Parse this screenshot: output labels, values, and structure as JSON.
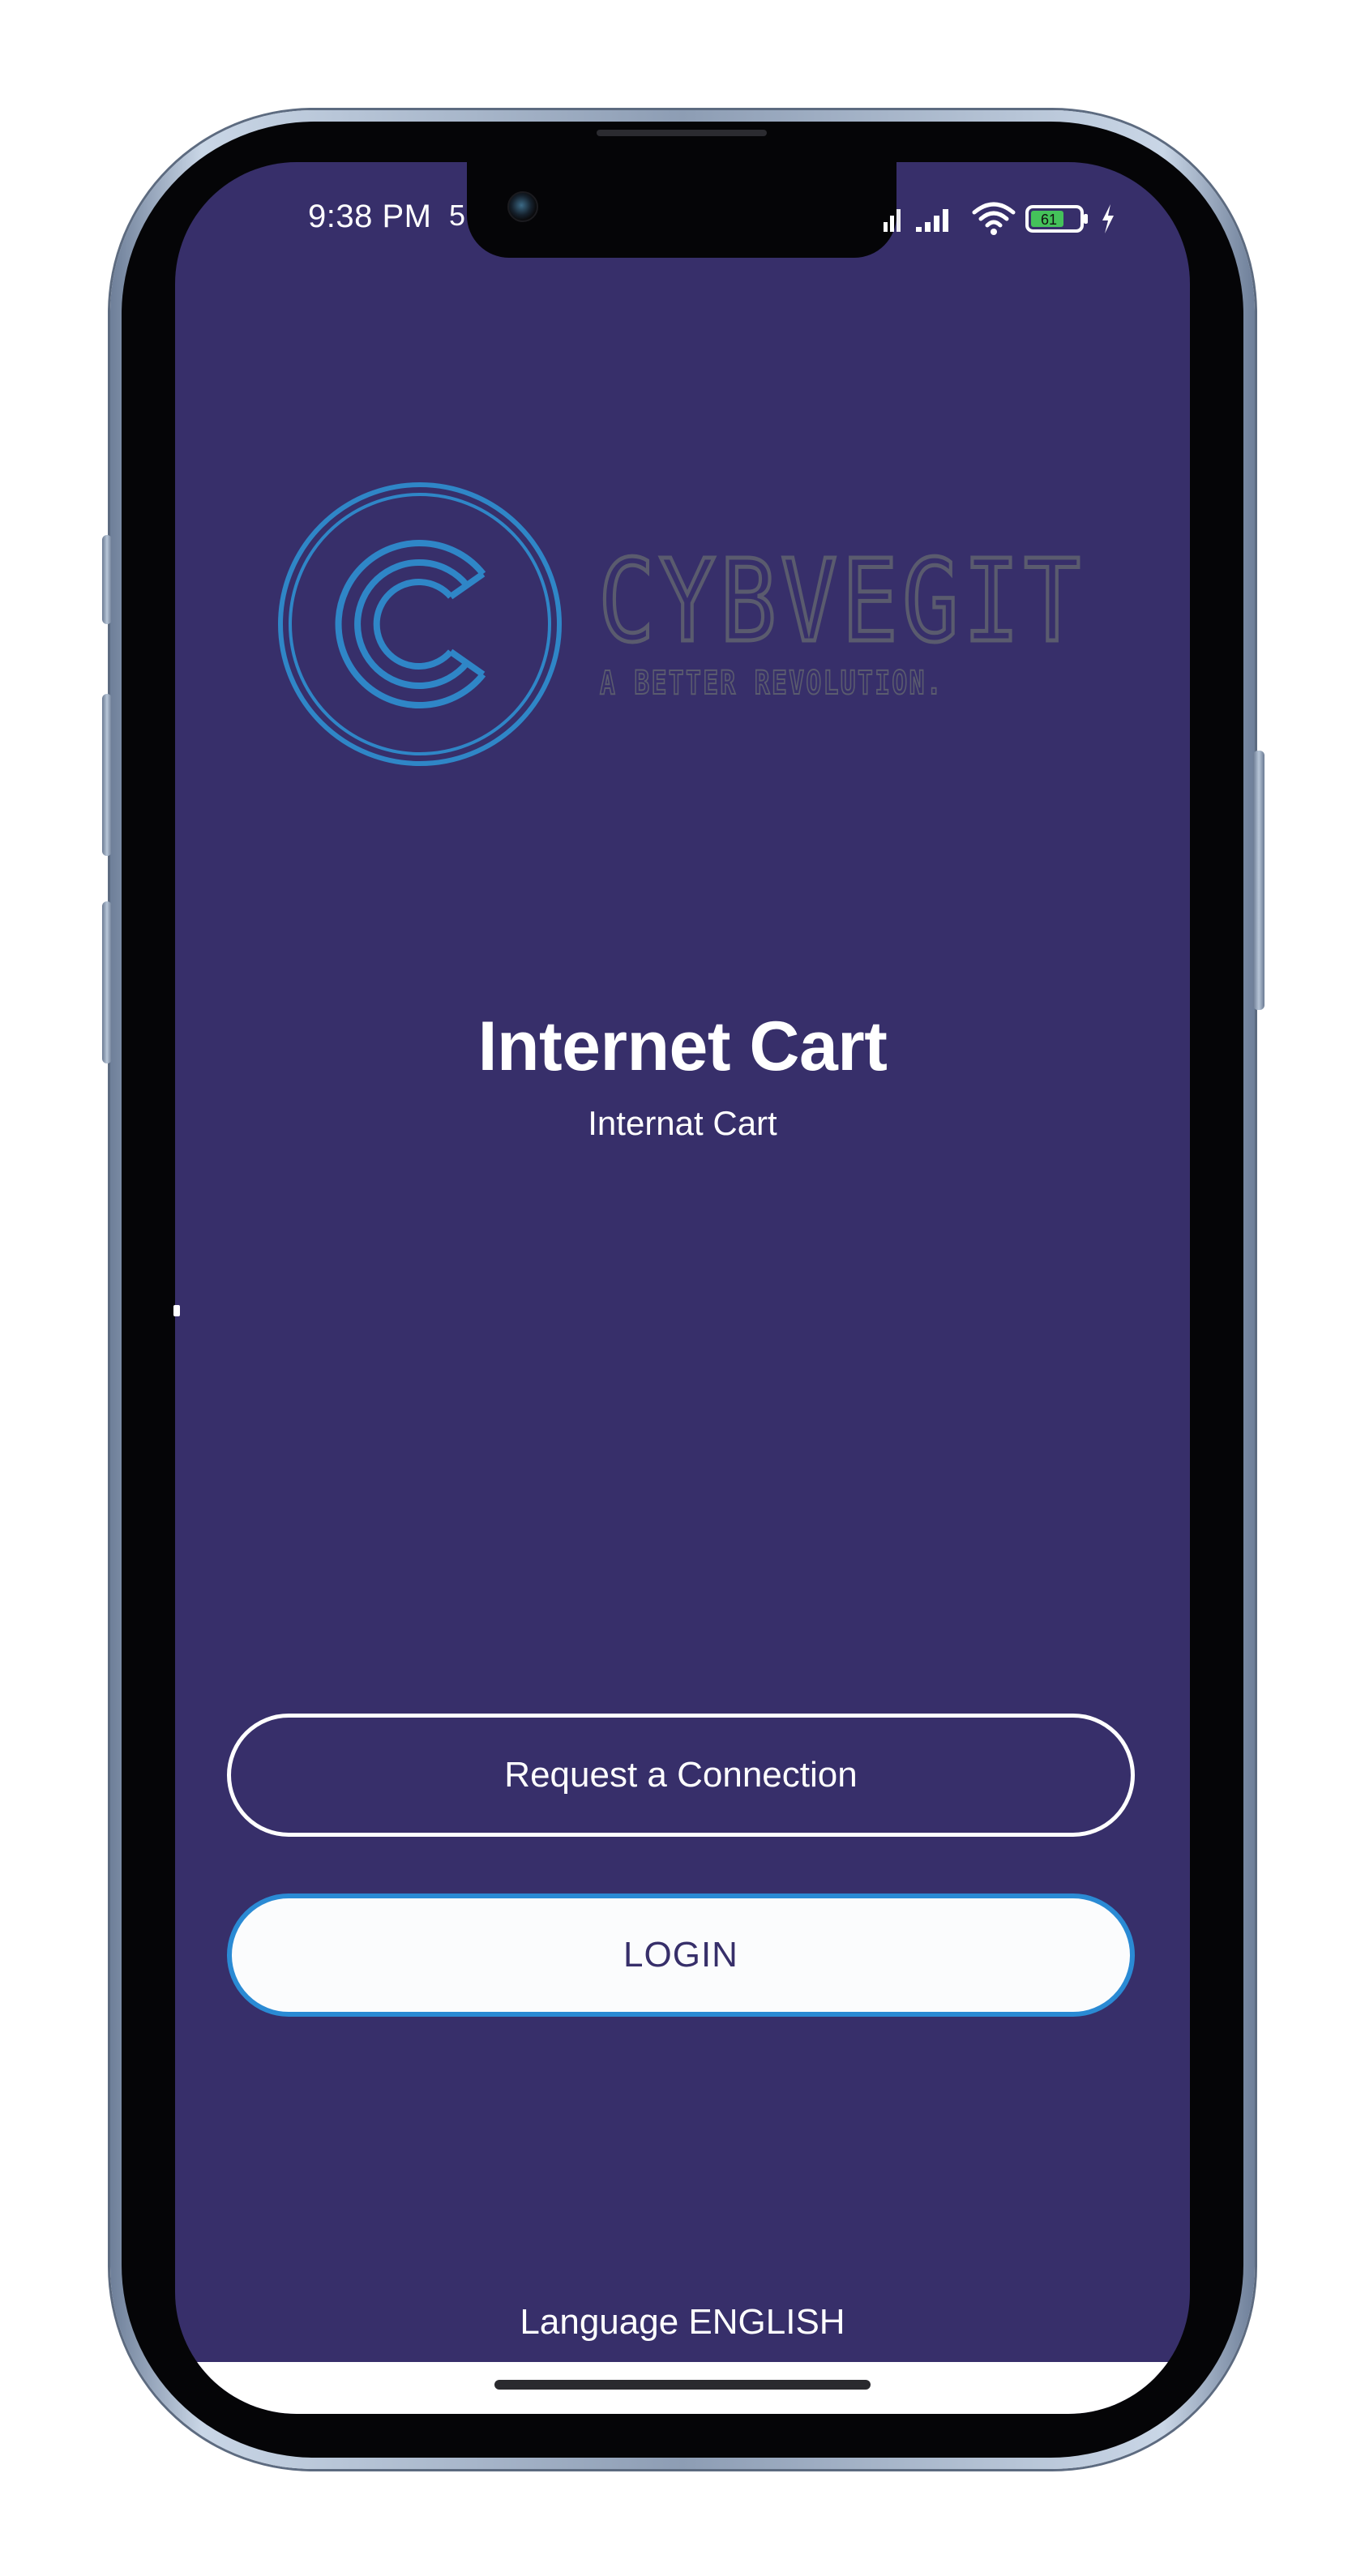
{
  "status_bar": {
    "time": "9:38 PM",
    "extra_indicator": "5",
    "battery_level": "61",
    "icons": [
      "signal-icon",
      "signal-icon",
      "wifi-icon",
      "battery-icon",
      "charging-icon"
    ]
  },
  "brand": {
    "name": "CYBVEGIT",
    "tagline": "A BETTER REVOLUTION.",
    "logo_letter": "C",
    "colors": {
      "ring": "#2f86c7",
      "text": "#5a5b6e",
      "background": "#372f6a"
    }
  },
  "app": {
    "title": "Internet Cart",
    "subtitle": "Internat Cart"
  },
  "actions": {
    "request_label": "Request a Connection",
    "login_label": "LOGIN"
  },
  "footer": {
    "language_label": "Language ENGLISH"
  },
  "colors": {
    "screen_background": "#372f6a",
    "login_border": "#2a8ad4",
    "login_text": "#372f6a"
  }
}
